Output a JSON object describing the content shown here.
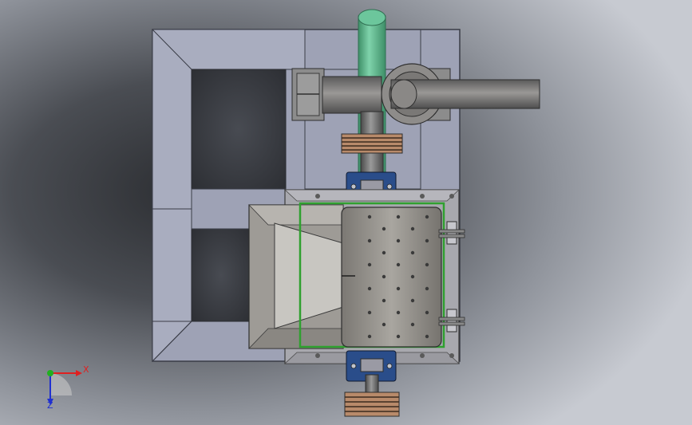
{
  "viewport": {
    "background": {
      "base": "#8b8f97",
      "left_shadow": "#2e3034",
      "right_light": "#c9ccd3"
    }
  },
  "model": {
    "frame_color": "#9ea2b5",
    "frame_edge": "#4a4d57",
    "dark_opening": "#3b3d44",
    "pipe_color": "#5ab38a",
    "shaft_color": "#6a6a6a",
    "bearing_color": "#2a4d8a",
    "pulley_color": "#8a6045",
    "plate_color": "#a8a8ae",
    "rotor_color": "#8e8b86",
    "seal_color": "#2fa02f",
    "hopper_color": "#aaa7a2",
    "hopper_inner": "#c8c6c1"
  },
  "triad": {
    "x_label": "X",
    "z_label": "Z",
    "x_color": "#e02020",
    "y_color": "#20b020",
    "z_color": "#2030d0"
  }
}
